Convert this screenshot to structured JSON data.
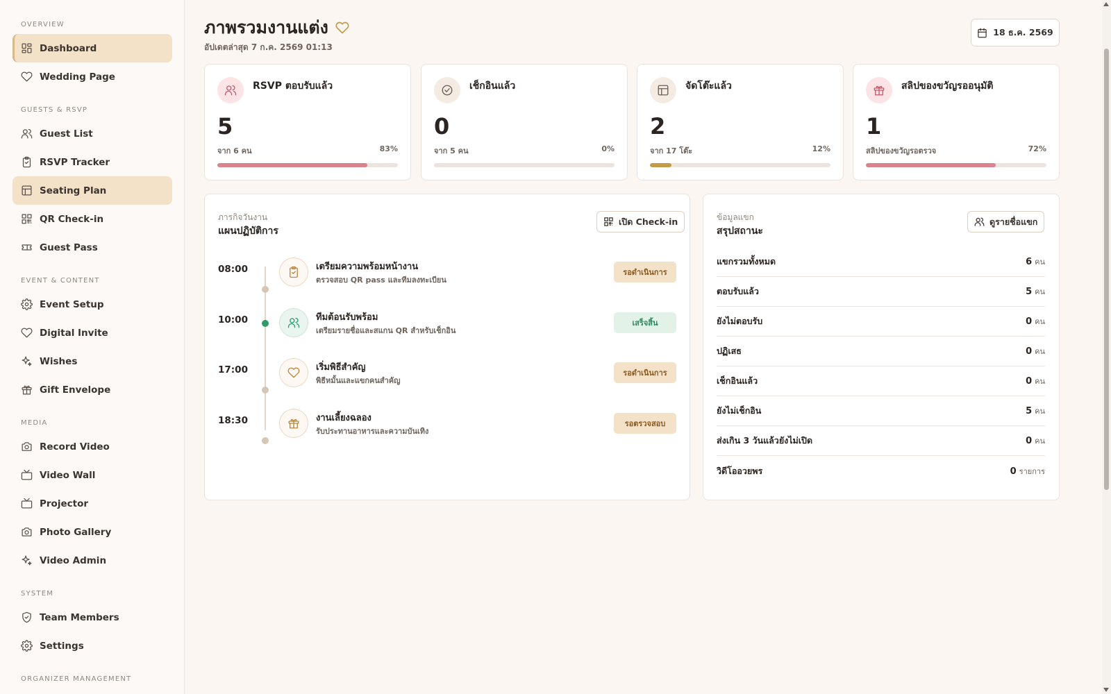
{
  "sidebar": {
    "sections": [
      {
        "title": "OVERVIEW",
        "items": [
          {
            "label": "Dashboard",
            "icon": "grid-icon"
          },
          {
            "label": "Wedding Page",
            "icon": "heart-icon"
          }
        ]
      },
      {
        "title": "GUESTS & RSVP",
        "items": [
          {
            "label": "Guest List",
            "icon": "users-icon"
          },
          {
            "label": "RSVP Tracker",
            "icon": "clipboard-icon"
          },
          {
            "label": "Seating Plan",
            "icon": "table-icon"
          },
          {
            "label": "QR Check-in",
            "icon": "qr-icon"
          },
          {
            "label": "Guest Pass",
            "icon": "ticket-icon"
          }
        ]
      },
      {
        "title": "EVENT & CONTENT",
        "items": [
          {
            "label": "Event Setup",
            "icon": "gear-icon"
          },
          {
            "label": "Digital Invite",
            "icon": "heart-icon"
          },
          {
            "label": "Wishes",
            "icon": "sparkle-icon"
          },
          {
            "label": "Gift Envelope",
            "icon": "gift-icon"
          }
        ]
      },
      {
        "title": "MEDIA",
        "items": [
          {
            "label": "Record Video",
            "icon": "camera-icon"
          },
          {
            "label": "Video Wall",
            "icon": "tv-icon"
          },
          {
            "label": "Projector",
            "icon": "tv-icon"
          },
          {
            "label": "Photo Gallery",
            "icon": "camera-icon"
          },
          {
            "label": "Video Admin",
            "icon": "sparkle-icon"
          }
        ]
      },
      {
        "title": "SYSTEM",
        "items": [
          {
            "label": "Team Members",
            "icon": "shield-icon"
          },
          {
            "label": "Settings",
            "icon": "gear-icon"
          }
        ]
      },
      {
        "title": "ORGANIZER MANAGEMENT",
        "items": []
      }
    ],
    "active": [
      "Dashboard",
      "Seating Plan"
    ]
  },
  "header": {
    "title": "ภาพรวมงานแต่ง",
    "updated": "อัปเดตล่าสุด 7 ก.ค. 2569 01:13",
    "date": "18 ธ.ค. 2569"
  },
  "stats": [
    {
      "label": "RSVP ตอบรับแล้ว",
      "value": "5",
      "sub": "จาก 6 คน",
      "pct": "83%",
      "fill": 0.83,
      "color": "#d9838f",
      "icon_bg": "#fbe3e6",
      "icon_color": "#c45a6a",
      "icon": "users-icon"
    },
    {
      "label": "เช็กอินแล้ว",
      "value": "0",
      "sub": "จาก 5 คน",
      "pct": "0%",
      "fill": 0,
      "color": "#c99a4b",
      "icon_bg": "#f4ece3",
      "icon_color": "#6b5f55",
      "icon": "check-circle-icon"
    },
    {
      "label": "จัดโต๊ะแล้ว",
      "value": "2",
      "sub": "จาก 17 โต๊ะ",
      "pct": "12%",
      "fill": 0.12,
      "color": "#c29a48",
      "icon_bg": "#f4ece3",
      "icon_color": "#6b5f55",
      "icon": "table-icon"
    },
    {
      "label": "สลิปของขวัญรออนุมัติ",
      "value": "1",
      "sub": "สลิปของขวัญรอตรวจ",
      "pct": "72%",
      "fill": 0.72,
      "color": "#d9838f",
      "icon_bg": "#fbe3e6",
      "icon_color": "#c45a6a",
      "icon": "gift-icon"
    }
  ],
  "timeline": {
    "eyebrow": "ภารกิจวันงาน",
    "title": "แผนปฏิบัติการ",
    "button": "เปิด Check-in",
    "items": [
      {
        "time": "08:00",
        "title": "เตรียมความพร้อมหน้างาน",
        "desc": "ตรวจสอบ QR pass และทีมลงทะเบียน",
        "badge": "รอดำเนินการ",
        "done": false,
        "icon": "clipboard-icon"
      },
      {
        "time": "10:00",
        "title": "ทีมต้อนรับพร้อม",
        "desc": "เตรียมรายชื่อและสแกน QR สำหรับเช็กอิน",
        "badge": "เสร็จสิ้น",
        "done": true,
        "icon": "users-icon"
      },
      {
        "time": "17:00",
        "title": "เริ่มพิธีสำคัญ",
        "desc": "พิธีหมั้นและแขกคนสำคัญ",
        "badge": "รอดำเนินการ",
        "done": false,
        "icon": "heart-icon"
      },
      {
        "time": "18:30",
        "title": "งานเลี้ยงฉลอง",
        "desc": "รับประทานอาหารและความบันเทิง",
        "badge": "รอตรวจสอบ",
        "done": false,
        "icon": "gift-icon"
      }
    ]
  },
  "summary": {
    "eyebrow": "ข้อมูลแขก",
    "title": "สรุปสถานะ",
    "button": "ดูรายชื่อแขก",
    "rows": [
      {
        "label": "แขกรวมทั้งหมด",
        "value": "6",
        "unit": "คน"
      },
      {
        "label": "ตอบรับแล้ว",
        "value": "5",
        "unit": "คน"
      },
      {
        "label": "ยังไม่ตอบรับ",
        "value": "0",
        "unit": "คน"
      },
      {
        "label": "ปฏิเสธ",
        "value": "0",
        "unit": "คน"
      },
      {
        "label": "เช็กอินแล้ว",
        "value": "0",
        "unit": "คน"
      },
      {
        "label": "ยังไม่เช็กอิน",
        "value": "5",
        "unit": "คน"
      },
      {
        "label": "ส่งเกิน 3 วันแล้วยังไม่เปิด",
        "value": "0",
        "unit": "คน"
      },
      {
        "label": "วิดีโออวยพร",
        "value": "0",
        "unit": "รายการ"
      }
    ]
  }
}
